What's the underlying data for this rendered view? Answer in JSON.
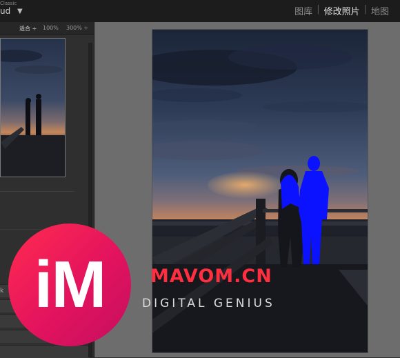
{
  "app": {
    "small_label": "Classic",
    "main_label": "ud",
    "menu_arrow": "▼"
  },
  "modules": [
    {
      "label": "图库",
      "active": false
    },
    {
      "label": "修改照片",
      "active": true
    },
    {
      "label": "地图",
      "active": false
    }
  ],
  "navigator": {
    "zoom_fit": "适合 ÷",
    "zoom_100": "100%",
    "zoom_300": "300% ÷"
  },
  "left_panel_fragment": "k",
  "watermark": {
    "logo_text": "iM",
    "title": "MAVOM.CN",
    "subtitle": "DIGITAL GENIUS",
    "title_color": "#ff2f3f",
    "logo_color": "#e3135e"
  },
  "mask_color": "#0b12ff"
}
